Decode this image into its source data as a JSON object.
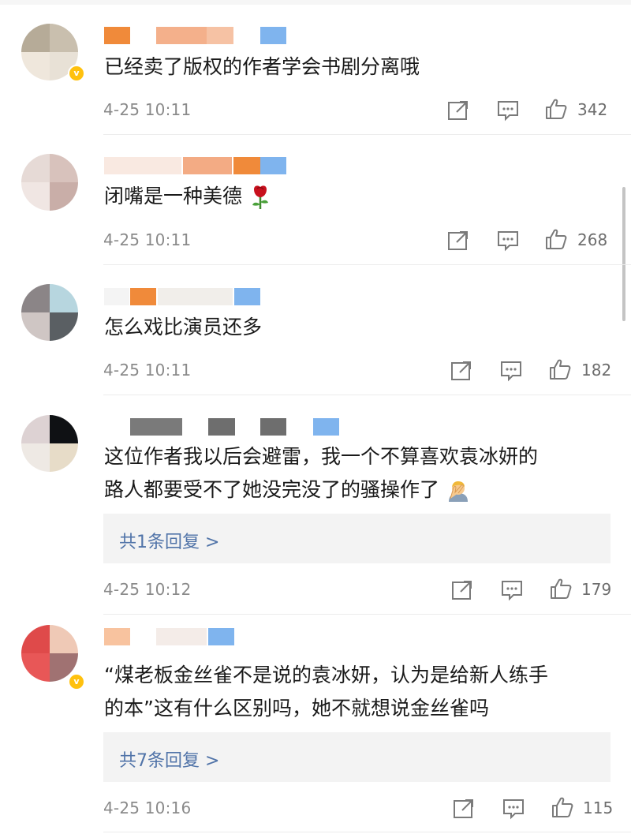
{
  "comments": [
    {
      "text_lines": [
        "已经卖了版权的作者学会书剧分离哦"
      ],
      "time": "4-25 10:11",
      "likes": "342",
      "avatar_colors": [
        "#b6ab98",
        "#c9bfae",
        "#efe7dc",
        "#e8e1d6"
      ],
      "verified": true
    },
    {
      "text_lines": [
        "闭嘴是一种美德"
      ],
      "emoji_label": "rose",
      "time": "4-25 10:11",
      "likes": "268",
      "avatar_colors": [
        "#e6dad6",
        "#d8c2bc",
        "#f0e6e3",
        "#c9aea8"
      ],
      "verified": false
    },
    {
      "text_lines": [
        "怎么戏比演员还多"
      ],
      "time": "4-25 10:11",
      "likes": "182",
      "avatar_colors": [
        "#8b8587",
        "#b7d6df",
        "#cfc6c4",
        "#5a5f63"
      ],
      "verified": false
    },
    {
      "text_lines": [
        "这位作者我以后会避雷，我一个不算喜欢袁冰妍的",
        "路人都要受不了她没完没了的骚操作了"
      ],
      "emoji_label": "facepalm",
      "reply_summary": "共1条回复 >",
      "time": "4-25 10:12",
      "likes": "179",
      "avatar_colors": [
        "#ddd2d3",
        "#0f1114",
        "#eee9e4",
        "#e7dcc8"
      ],
      "verified": false
    },
    {
      "text_lines": [
        "“煤老板金丝雀不是说的袁冰妍，认为是给新人练手",
        "的本”这有什么区别吗，她不就想说金丝雀吗"
      ],
      "reply_summary": "共7条回复 >",
      "time": "4-25 10:16",
      "likes": "115",
      "avatar_colors": [
        "#df4a4a",
        "#efc9b6",
        "#e85757",
        "#a07272"
      ],
      "verified": true
    }
  ],
  "colors": {
    "text": "#1a1a1a",
    "meta": "#8a8a8a",
    "link": "#5073a8",
    "reply_bg": "#f3f3f3",
    "verified": "#ffc10e"
  },
  "icons": [
    "share-icon",
    "comment-icon",
    "like-icon",
    "rose-emoji",
    "facepalm-emoji"
  ]
}
